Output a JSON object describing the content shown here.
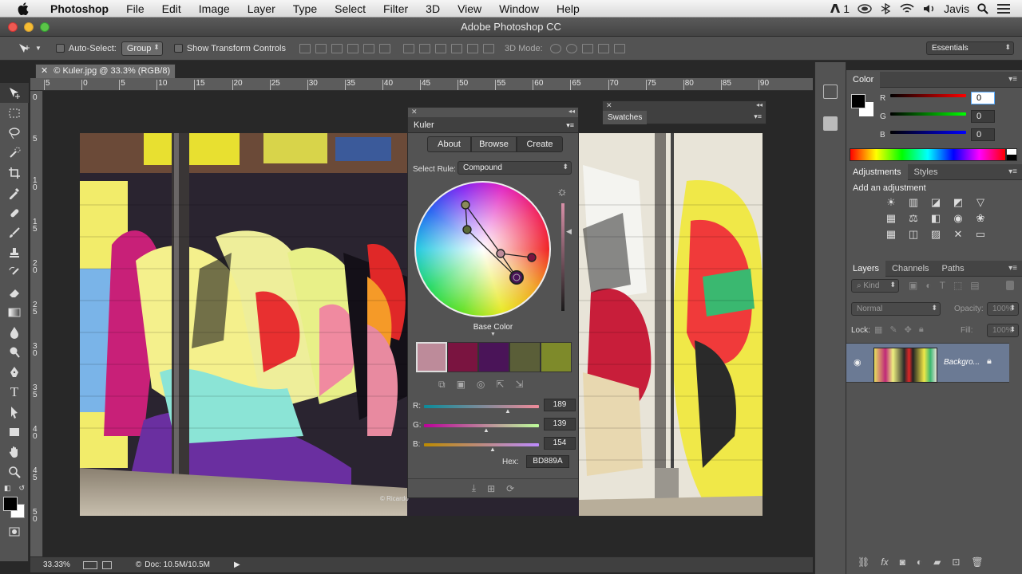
{
  "menubar": {
    "app_name": "Photoshop",
    "items": [
      "File",
      "Edit",
      "Image",
      "Layer",
      "Type",
      "Select",
      "Filter",
      "3D",
      "View",
      "Window",
      "Help"
    ],
    "status_badge": "1",
    "user": "Javis"
  },
  "window": {
    "title": "Adobe Photoshop CC"
  },
  "options_bar": {
    "auto_select_label": "Auto-Select:",
    "auto_select_value": "Group",
    "transform_label": "Show Transform Controls",
    "mode_3d_label": "3D Mode:",
    "workspace": "Essentials"
  },
  "document": {
    "tab_title": "© Kuler.jpg @ 33.3% (RGB/8)",
    "ruler_h": [
      "5",
      "0",
      "5",
      "10",
      "15",
      "20",
      "25",
      "30",
      "35",
      "40",
      "45",
      "50",
      "55",
      "60",
      "65",
      "70",
      "75",
      "80",
      "85",
      "90"
    ],
    "ruler_v": [
      "0",
      "5",
      "1\n0",
      "1\n5",
      "2\n0",
      "2\n5",
      "3\n0",
      "3\n5",
      "4\n0",
      "4\n5",
      "5\n0"
    ],
    "watermark": "© Ricardo"
  },
  "status": {
    "zoom": "33.33%",
    "doc_size": "Doc: 10.5M/10.5M"
  },
  "kuler": {
    "title": "Kuler",
    "tabs": [
      "About",
      "Browse",
      "Create"
    ],
    "active_tab": "Create",
    "select_rule_label": "Select Rule:",
    "select_rule_value": "Compound",
    "base_color_label": "Base Color",
    "swatches": [
      "#BD8B9A",
      "#7A1440",
      "#4A1458",
      "#5A5E38",
      "#7E8A2A"
    ],
    "r_label": "R:",
    "r_value": "189",
    "g_label": "G:",
    "g_value": "139",
    "b_label": "B:",
    "b_value": "154",
    "hex_label": "Hex:",
    "hex_value": "BD889A"
  },
  "swatches_panel": {
    "title": "Swatches"
  },
  "color_panel": {
    "title": "Color",
    "r_label": "R",
    "r_value": "0",
    "g_label": "G",
    "g_value": "0",
    "b_label": "B",
    "b_value": "0"
  },
  "adjustments_panel": {
    "tabs": [
      "Adjustments",
      "Styles"
    ],
    "add_label": "Add an adjustment"
  },
  "layers_panel": {
    "tabs": [
      "Layers",
      "Channels",
      "Paths"
    ],
    "kind_label": "Kind",
    "blend_mode": "Normal",
    "opacity_label": "Opacity:",
    "opacity_value": "100%",
    "lock_label": "Lock:",
    "fill_label": "Fill:",
    "fill_value": "100%",
    "layer_name": "Backgro..."
  },
  "colors": {
    "accent": "#2d6ec8",
    "panel_bg": "#535353"
  }
}
